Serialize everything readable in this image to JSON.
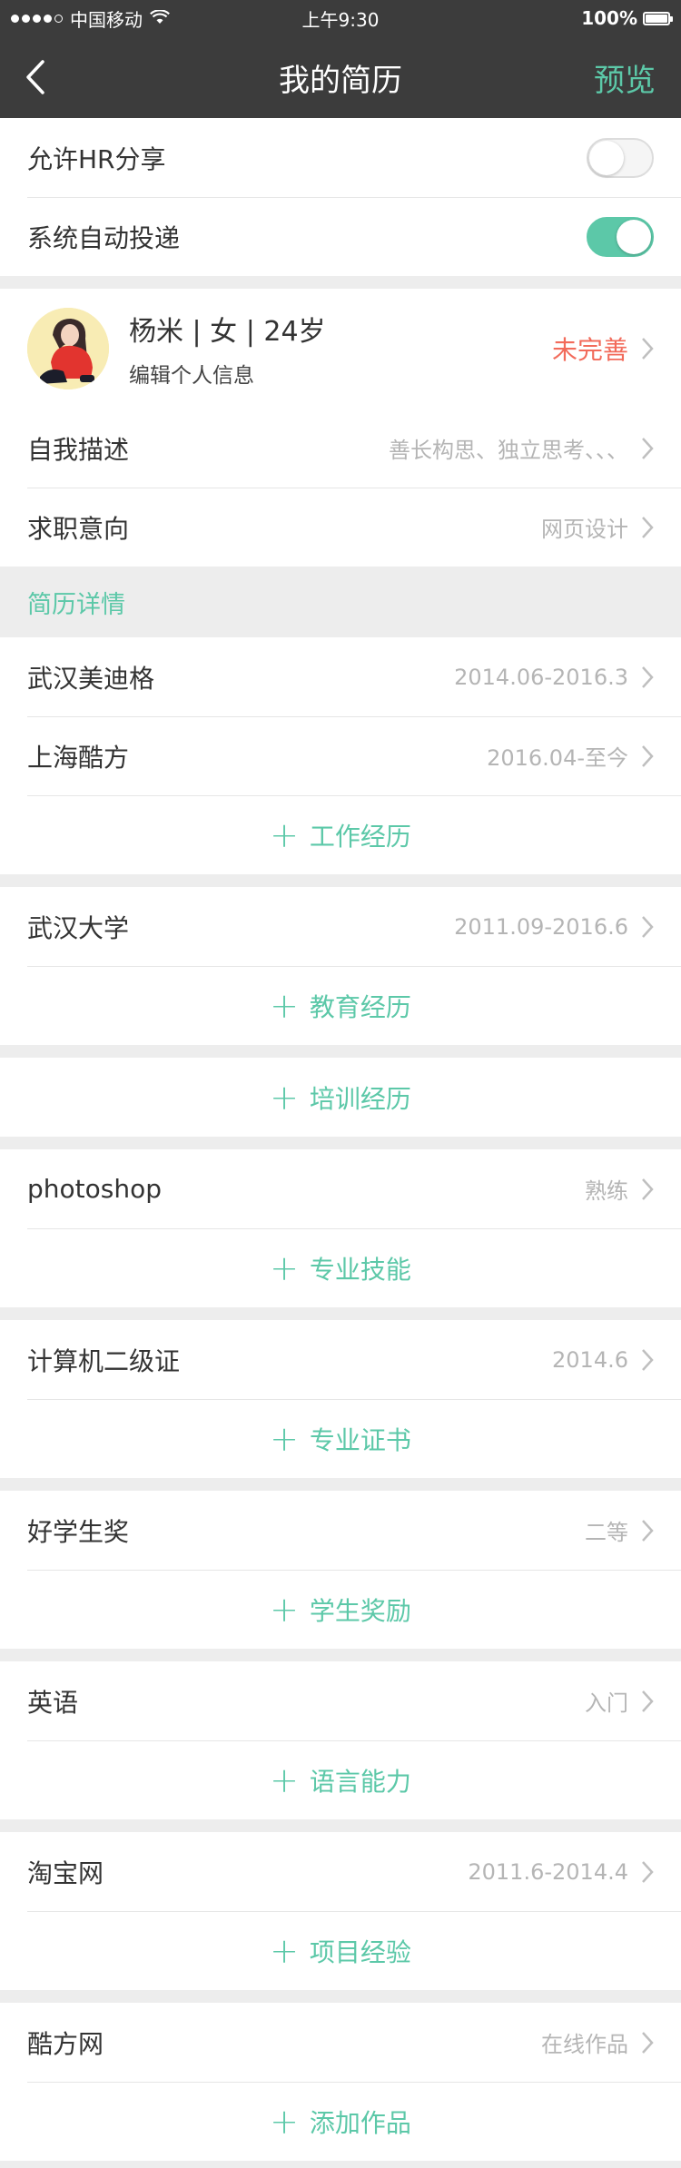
{
  "status_bar": {
    "carrier": "中国移动",
    "time": "上午9:30",
    "battery": "100%"
  },
  "nav": {
    "title": "我的简历",
    "preview": "预览"
  },
  "settings": [
    {
      "label": "允许HR分享",
      "on": false
    },
    {
      "label": "系统自动投递",
      "on": true
    }
  ],
  "profile": {
    "name": "杨米 | 女 | 24岁",
    "edit": "编辑个人信息",
    "status": "未完善"
  },
  "basic": [
    {
      "label": "自我描述",
      "value": "善长构思、独立思考、、、"
    },
    {
      "label": "求职意向",
      "value": "网页设计"
    }
  ],
  "details_header": "简历详情",
  "work": {
    "items": [
      {
        "label": "武汉美迪格",
        "value": "2014.06-2016.3"
      },
      {
        "label": "上海酷方",
        "value": "2016.04-至今"
      }
    ],
    "add": "工作经历"
  },
  "education": {
    "items": [
      {
        "label": "武汉大学",
        "value": "2011.09-2016.6"
      }
    ],
    "add": "教育经历"
  },
  "training": {
    "add": "培训经历"
  },
  "skills": {
    "items": [
      {
        "label": "photoshop",
        "value": "熟练"
      }
    ],
    "add": "专业技能"
  },
  "certificates": {
    "items": [
      {
        "label": "计算机二级证",
        "value": "2014.6"
      }
    ],
    "add": "专业证书"
  },
  "awards": {
    "items": [
      {
        "label": "好学生奖",
        "value": "二等"
      }
    ],
    "add": "学生奖励"
  },
  "languages": {
    "items": [
      {
        "label": "英语",
        "value": "入门"
      }
    ],
    "add": "语言能力"
  },
  "projects": {
    "items": [
      {
        "label": "淘宝网",
        "value": "2011.6-2014.4"
      }
    ],
    "add": "项目经验"
  },
  "works": {
    "items": [
      {
        "label": "酷方网",
        "value": "在线作品"
      }
    ],
    "add": "添加作品"
  },
  "colors": {
    "accent": "#5cc8a8",
    "header_bg": "#3c3c3c",
    "warning": "#f26b5b"
  }
}
